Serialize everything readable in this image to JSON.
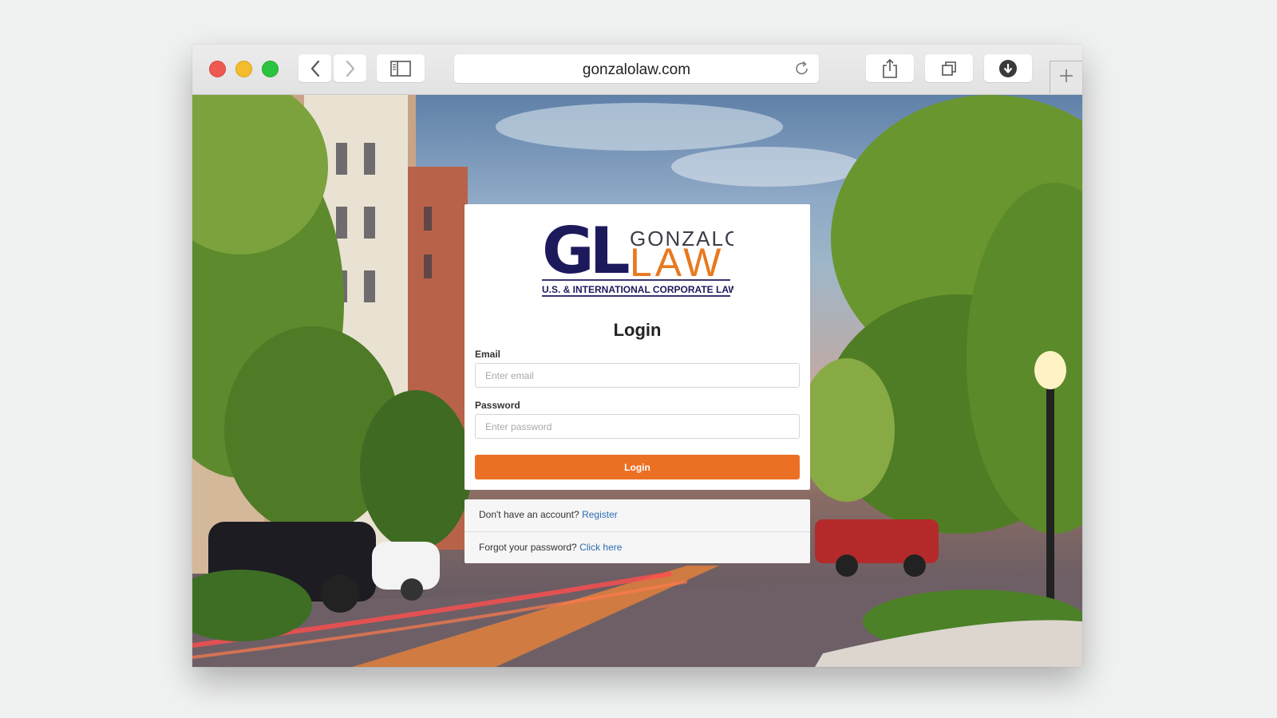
{
  "browser": {
    "url": "gonzalolaw.com",
    "icons": {
      "back": "chevron-left-icon",
      "forward": "chevron-right-icon",
      "sidebar": "sidebar-icon",
      "reload": "reload-icon",
      "share": "share-icon",
      "tabs": "tabs-overview-icon",
      "downloads": "download-icon",
      "new_tab": "plus-icon"
    }
  },
  "logo": {
    "monogram": "GL",
    "name_top": "GONZALO",
    "name_bottom": "LAW",
    "tagline": "U.S. & INTERNATIONAL CORPORATE LAW",
    "colors": {
      "navy": "#1d1a5c",
      "orange": "#e8791f",
      "gray": "#3d3d4a"
    }
  },
  "form": {
    "title": "Login",
    "email_label": "Email",
    "email_placeholder": "Enter email",
    "email_value": "",
    "password_label": "Password",
    "password_placeholder": "Enter password",
    "password_value": "",
    "submit_label": "Login",
    "accent": "#ec7024"
  },
  "footer": {
    "register_prompt": "Don't have an account?",
    "register_link": "Register",
    "forgot_prompt": "Forgot your password?",
    "forgot_link": "Click here",
    "link_color": "#2b6cb0"
  }
}
